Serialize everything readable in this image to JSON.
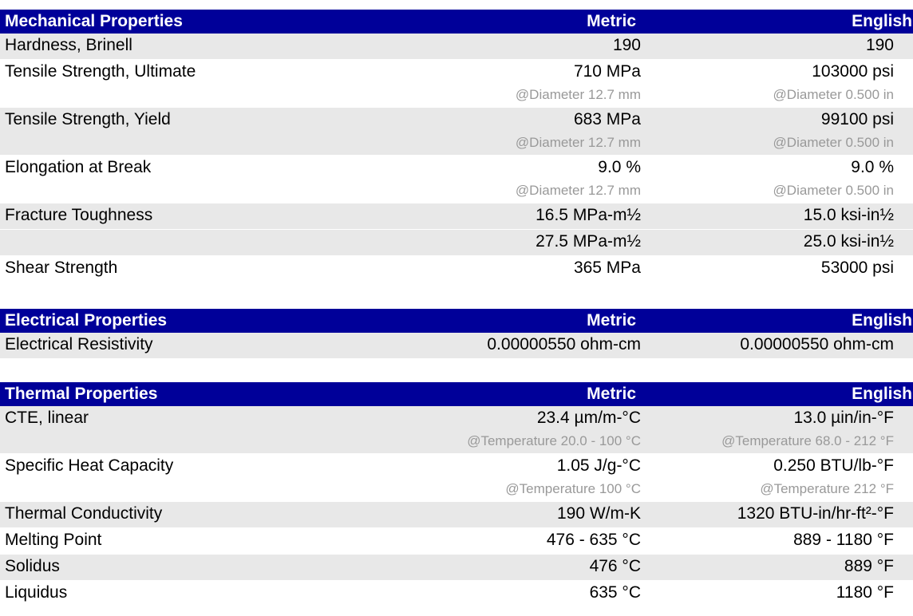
{
  "sections": [
    {
      "title": "Mechanical Properties",
      "metric_header": "Metric",
      "english_header": "English",
      "rows": [
        {
          "name": "Hardness, Brinell",
          "metric": "190",
          "english": "190"
        },
        {
          "name": "Tensile Strength, Ultimate",
          "metric": "710 MPa",
          "metric_cond": "@Diameter 12.7 mm",
          "english": "103000 psi",
          "english_cond": "@Diameter 0.500 in"
        },
        {
          "name": "Tensile Strength, Yield",
          "metric": "683 MPa",
          "metric_cond": "@Diameter 12.7 mm",
          "english": "99100 psi",
          "english_cond": "@Diameter 0.500 in"
        },
        {
          "name": "Elongation at Break",
          "metric": "9.0 %",
          "metric_cond": "@Diameter 12.7 mm",
          "english": "9.0 %",
          "english_cond": "@Diameter 0.500 in"
        },
        {
          "name": "Fracture Toughness",
          "metric": "16.5 MPa-m½",
          "english": "15.0 ksi-in½"
        },
        {
          "name": "",
          "metric": "27.5 MPa-m½",
          "english": "25.0 ksi-in½"
        },
        {
          "name": "Shear Strength",
          "metric": "365 MPa",
          "english": "53000 psi"
        }
      ]
    },
    {
      "title": "Electrical Properties",
      "metric_header": "Metric",
      "english_header": "English",
      "rows": [
        {
          "name": "Electrical Resistivity",
          "metric": "0.00000550 ohm-cm",
          "english": "0.00000550 ohm-cm"
        }
      ]
    },
    {
      "title": "Thermal Properties",
      "metric_header": "Metric",
      "english_header": "English",
      "rows": [
        {
          "name": "CTE, linear",
          "metric": "23.4 µm/m-°C",
          "metric_cond": "@Temperature 20.0 - 100 °C",
          "english": "13.0 µin/in-°F",
          "english_cond": "@Temperature 68.0 - 212 °F"
        },
        {
          "name": "Specific Heat Capacity",
          "metric": "1.05 J/g-°C",
          "metric_cond": "@Temperature 100 °C",
          "english": "0.250 BTU/lb-°F",
          "english_cond": "@Temperature 212 °F"
        },
        {
          "name": "Thermal Conductivity",
          "metric": "190 W/m-K",
          "english": "1320 BTU-in/hr-ft²-°F"
        },
        {
          "name": "Melting Point",
          "metric": "476 - 635 °C",
          "english": "889 - 1180 °F"
        },
        {
          "name": "Solidus",
          "metric": "476 °C",
          "english": "889 °F"
        },
        {
          "name": "Liquidus",
          "metric": "635 °C",
          "english": "1180 °F"
        }
      ]
    }
  ]
}
